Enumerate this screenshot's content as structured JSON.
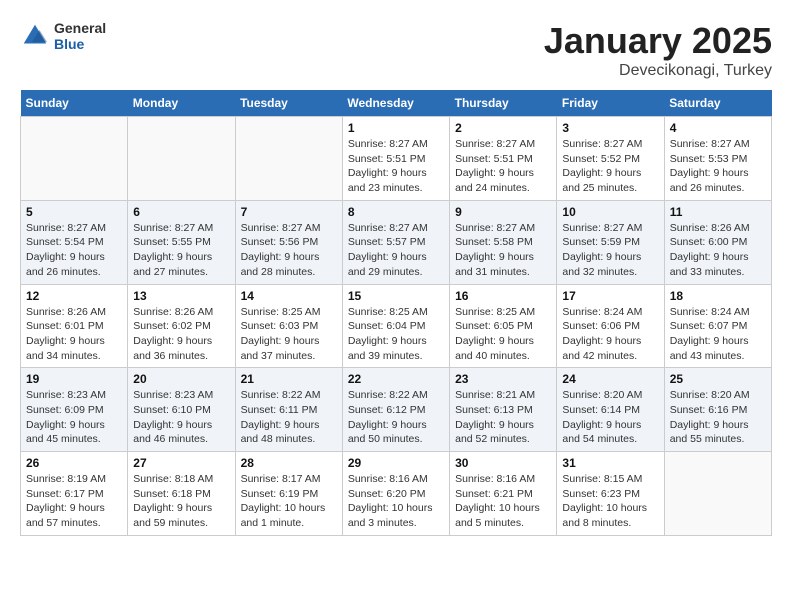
{
  "header": {
    "logo_general": "General",
    "logo_blue": "Blue",
    "month": "January 2025",
    "location": "Devecikonagi, Turkey"
  },
  "days_of_week": [
    "Sunday",
    "Monday",
    "Tuesday",
    "Wednesday",
    "Thursday",
    "Friday",
    "Saturday"
  ],
  "weeks": [
    [
      {
        "day": "",
        "info": ""
      },
      {
        "day": "",
        "info": ""
      },
      {
        "day": "",
        "info": ""
      },
      {
        "day": "1",
        "info": "Sunrise: 8:27 AM\nSunset: 5:51 PM\nDaylight: 9 hours\nand 23 minutes."
      },
      {
        "day": "2",
        "info": "Sunrise: 8:27 AM\nSunset: 5:51 PM\nDaylight: 9 hours\nand 24 minutes."
      },
      {
        "day": "3",
        "info": "Sunrise: 8:27 AM\nSunset: 5:52 PM\nDaylight: 9 hours\nand 25 minutes."
      },
      {
        "day": "4",
        "info": "Sunrise: 8:27 AM\nSunset: 5:53 PM\nDaylight: 9 hours\nand 26 minutes."
      }
    ],
    [
      {
        "day": "5",
        "info": "Sunrise: 8:27 AM\nSunset: 5:54 PM\nDaylight: 9 hours\nand 26 minutes."
      },
      {
        "day": "6",
        "info": "Sunrise: 8:27 AM\nSunset: 5:55 PM\nDaylight: 9 hours\nand 27 minutes."
      },
      {
        "day": "7",
        "info": "Sunrise: 8:27 AM\nSunset: 5:56 PM\nDaylight: 9 hours\nand 28 minutes."
      },
      {
        "day": "8",
        "info": "Sunrise: 8:27 AM\nSunset: 5:57 PM\nDaylight: 9 hours\nand 29 minutes."
      },
      {
        "day": "9",
        "info": "Sunrise: 8:27 AM\nSunset: 5:58 PM\nDaylight: 9 hours\nand 31 minutes."
      },
      {
        "day": "10",
        "info": "Sunrise: 8:27 AM\nSunset: 5:59 PM\nDaylight: 9 hours\nand 32 minutes."
      },
      {
        "day": "11",
        "info": "Sunrise: 8:26 AM\nSunset: 6:00 PM\nDaylight: 9 hours\nand 33 minutes."
      }
    ],
    [
      {
        "day": "12",
        "info": "Sunrise: 8:26 AM\nSunset: 6:01 PM\nDaylight: 9 hours\nand 34 minutes."
      },
      {
        "day": "13",
        "info": "Sunrise: 8:26 AM\nSunset: 6:02 PM\nDaylight: 9 hours\nand 36 minutes."
      },
      {
        "day": "14",
        "info": "Sunrise: 8:25 AM\nSunset: 6:03 PM\nDaylight: 9 hours\nand 37 minutes."
      },
      {
        "day": "15",
        "info": "Sunrise: 8:25 AM\nSunset: 6:04 PM\nDaylight: 9 hours\nand 39 minutes."
      },
      {
        "day": "16",
        "info": "Sunrise: 8:25 AM\nSunset: 6:05 PM\nDaylight: 9 hours\nand 40 minutes."
      },
      {
        "day": "17",
        "info": "Sunrise: 8:24 AM\nSunset: 6:06 PM\nDaylight: 9 hours\nand 42 minutes."
      },
      {
        "day": "18",
        "info": "Sunrise: 8:24 AM\nSunset: 6:07 PM\nDaylight: 9 hours\nand 43 minutes."
      }
    ],
    [
      {
        "day": "19",
        "info": "Sunrise: 8:23 AM\nSunset: 6:09 PM\nDaylight: 9 hours\nand 45 minutes."
      },
      {
        "day": "20",
        "info": "Sunrise: 8:23 AM\nSunset: 6:10 PM\nDaylight: 9 hours\nand 46 minutes."
      },
      {
        "day": "21",
        "info": "Sunrise: 8:22 AM\nSunset: 6:11 PM\nDaylight: 9 hours\nand 48 minutes."
      },
      {
        "day": "22",
        "info": "Sunrise: 8:22 AM\nSunset: 6:12 PM\nDaylight: 9 hours\nand 50 minutes."
      },
      {
        "day": "23",
        "info": "Sunrise: 8:21 AM\nSunset: 6:13 PM\nDaylight: 9 hours\nand 52 minutes."
      },
      {
        "day": "24",
        "info": "Sunrise: 8:20 AM\nSunset: 6:14 PM\nDaylight: 9 hours\nand 54 minutes."
      },
      {
        "day": "25",
        "info": "Sunrise: 8:20 AM\nSunset: 6:16 PM\nDaylight: 9 hours\nand 55 minutes."
      }
    ],
    [
      {
        "day": "26",
        "info": "Sunrise: 8:19 AM\nSunset: 6:17 PM\nDaylight: 9 hours\nand 57 minutes."
      },
      {
        "day": "27",
        "info": "Sunrise: 8:18 AM\nSunset: 6:18 PM\nDaylight: 9 hours\nand 59 minutes."
      },
      {
        "day": "28",
        "info": "Sunrise: 8:17 AM\nSunset: 6:19 PM\nDaylight: 10 hours\nand 1 minute."
      },
      {
        "day": "29",
        "info": "Sunrise: 8:16 AM\nSunset: 6:20 PM\nDaylight: 10 hours\nand 3 minutes."
      },
      {
        "day": "30",
        "info": "Sunrise: 8:16 AM\nSunset: 6:21 PM\nDaylight: 10 hours\nand 5 minutes."
      },
      {
        "day": "31",
        "info": "Sunrise: 8:15 AM\nSunset: 6:23 PM\nDaylight: 10 hours\nand 8 minutes."
      },
      {
        "day": "",
        "info": ""
      }
    ]
  ]
}
